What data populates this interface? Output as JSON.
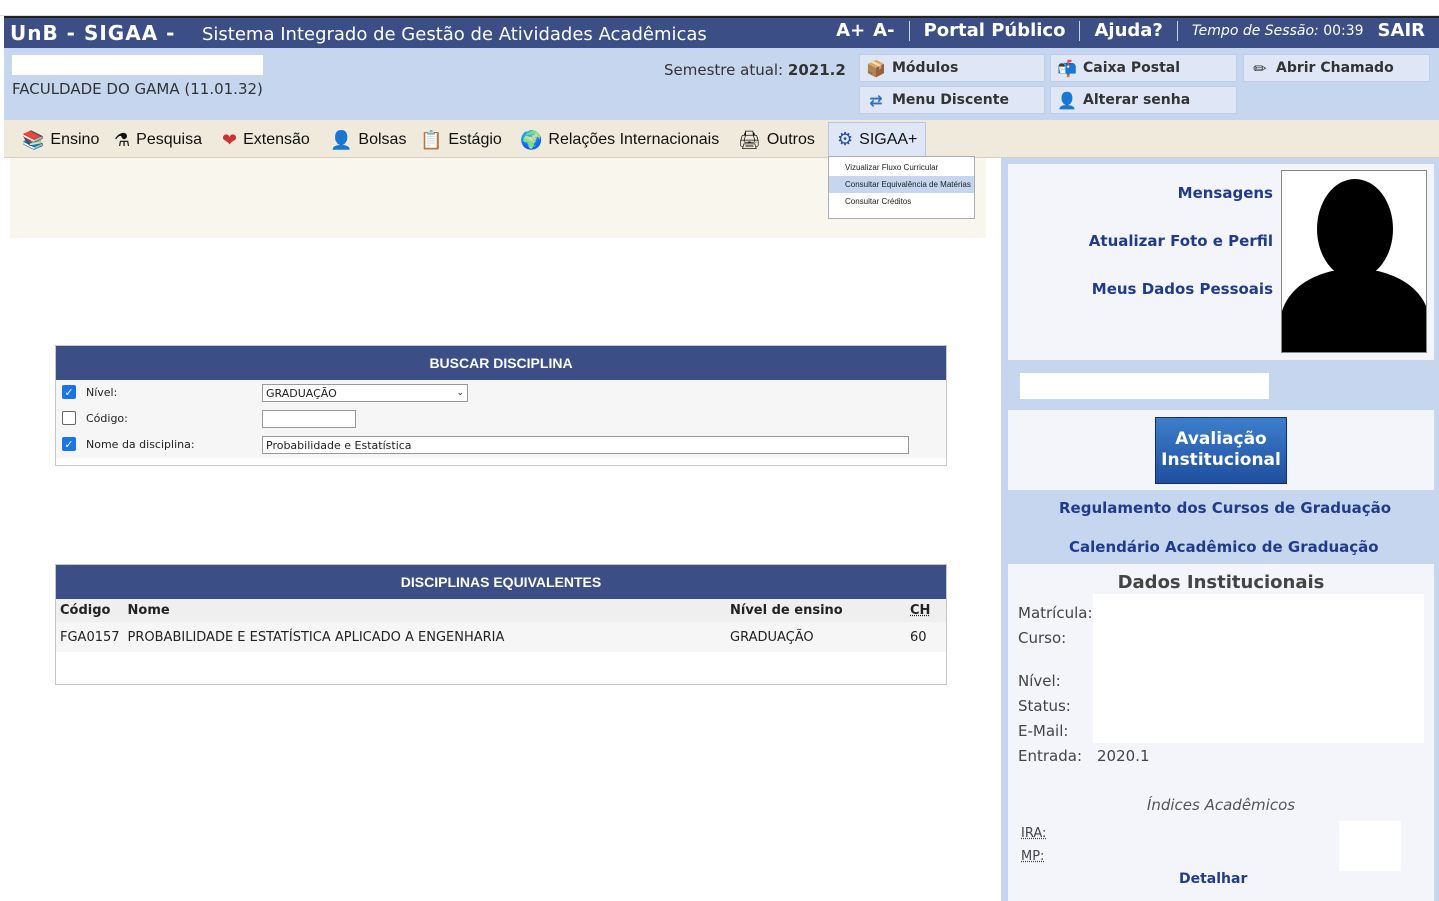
{
  "header": {
    "brand": "UnB - SIGAA -",
    "system_name": "Sistema Integrado de Gestão de Atividades Acadêmicas",
    "font_increase": "A+",
    "font_decrease": "A-",
    "portal_publico": "Portal Público",
    "ajuda": "Ajuda?",
    "session_label": "Tempo de Sessão:",
    "session_time": "00:39",
    "sair": "SAIR"
  },
  "info": {
    "faculty": "FACULDADE DO GAMA (11.01.32)",
    "semestre_label": "Semestre atual:",
    "semestre_value": "2021.2"
  },
  "quick_menu": {
    "modulos": "Módulos",
    "caixa_postal": "Caixa Postal",
    "abrir_chamado": "Abrir Chamado",
    "menu_discente": "Menu Discente",
    "alterar_senha": "Alterar senha"
  },
  "menu": {
    "ensino": "Ensino",
    "pesquisa": "Pesquisa",
    "extensao": "Extensão",
    "bolsas": "Bolsas",
    "estagio": "Estágio",
    "relacoes": "Relações Internacionais",
    "outros": "Outros",
    "sigaa_plus": "SIGAA+"
  },
  "dropdown": {
    "items": [
      "Vizualizar Fluxo Curricular",
      "Consultar Equivalência de Matérias",
      "Consultar Créditos"
    ]
  },
  "buscar": {
    "title": "BUSCAR DISCIPLINA",
    "nivel_label": "Nível:",
    "nivel_value": "GRADUAÇÃO",
    "codigo_label": "Código:",
    "codigo_value": "",
    "nome_label": "Nome da disciplina:",
    "nome_value": "Probabilidade e Estatística"
  },
  "equivalentes": {
    "title": "DISCIPLINAS EQUIVALENTES",
    "columns": [
      "Código",
      "Nome",
      "Nível de ensino",
      "CH"
    ],
    "rows": [
      [
        "FGA0157",
        "PROBABILIDADE E ESTATÍSTICA APLICADO A ENGENHARIA",
        "GRADUAÇÃO",
        "60"
      ]
    ]
  },
  "sidebar": {
    "mensagens": "Mensagens",
    "atualizar_foto": "Atualizar Foto e Perfil",
    "meus_dados": "Meus Dados Pessoais",
    "avaliacao_line1": "Avaliação",
    "avaliacao_line2": "Institucional",
    "regulamento": "Regulamento dos Cursos de Graduação",
    "calendario": "Calendário Acadêmico de Graduação",
    "dados_title": "Dados Institucionais",
    "matricula_label": "Matrícula:",
    "curso_label": "Curso:",
    "nivel_label": "Nível:",
    "status_label": "Status:",
    "email_label": "E-Mail:",
    "entrada_label": "Entrada:",
    "entrada_value": "2020.1",
    "indices_title": "Índices Acadêmicos",
    "ira_label": "IRA:",
    "mp_label": "MP:",
    "detalhar": "Detalhar"
  }
}
